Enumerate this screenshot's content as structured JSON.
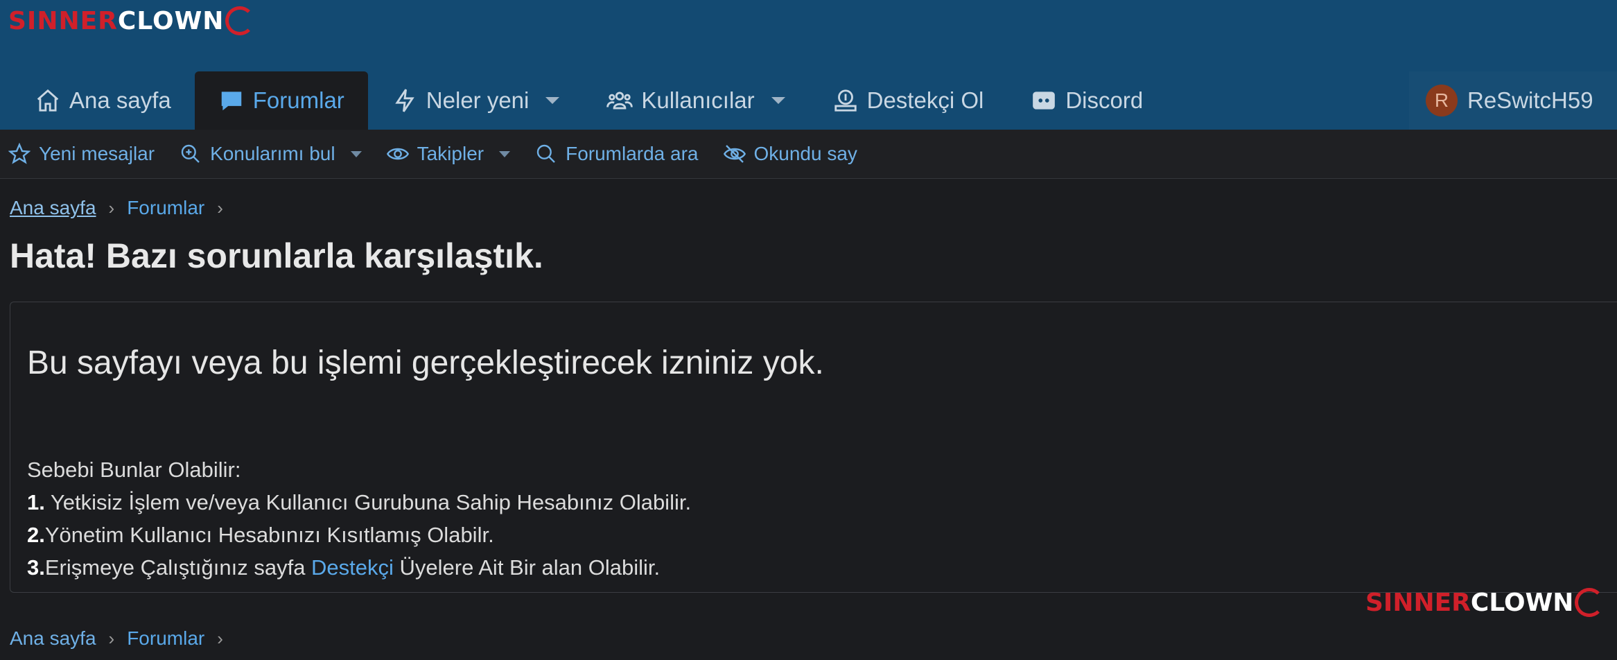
{
  "brand": {
    "part1": "SINNER",
    "part2": "CLOWN"
  },
  "main_nav": [
    {
      "label": "Ana sayfa",
      "icon": "home-icon"
    },
    {
      "label": "Forumlar",
      "icon": "comment-icon",
      "active": true
    },
    {
      "label": "Neler yeni",
      "icon": "bolt-icon",
      "dropdown": true
    },
    {
      "label": "Kullanıcılar",
      "icon": "users-icon",
      "dropdown": true
    },
    {
      "label": "Destekçi Ol",
      "icon": "donate-icon"
    },
    {
      "label": "Discord",
      "icon": "discord-icon"
    }
  ],
  "account": {
    "avatar_letter": "R",
    "username": "ReSwitcH59"
  },
  "sub_nav": [
    {
      "label": "Yeni mesajlar",
      "icon": "star-icon"
    },
    {
      "label": "Konularımı bul",
      "icon": "search-plus-icon",
      "dropdown": true
    },
    {
      "label": "Takipler",
      "icon": "eye-icon",
      "dropdown": true
    },
    {
      "label": "Forumlarda ara",
      "icon": "search-icon"
    },
    {
      "label": "Okundu say",
      "icon": "eye-slash-icon"
    }
  ],
  "breadcrumb": {
    "home": "Ana sayfa",
    "forums": "Forumlar"
  },
  "page_title": "Hata! Bazı sorunlarla karşılaştık.",
  "error": {
    "message": "Bu sayfayı veya bu işlemi gerçekleştirecek izniniz yok.",
    "reasons_heading": "Sebebi Bunlar Olabilir:",
    "r1_num": "1.",
    "r1_text": " Yetkisiz İşlem ve/veya Kullanıcı Gurubuna Sahip Hesabınız Olabilir.",
    "r2_num": "2.",
    "r2_text": "Yönetim Kullanıcı Hesabınızı Kısıtlamış Olabilr.",
    "r3_num": "3.",
    "r3_text_a": "Erişmeye Çalıştığınız sayfa ",
    "r3_link": "Destekçi",
    "r3_text_b": " Üyelere Ait Bir alan Olabilir."
  },
  "colors": {
    "header_bg": "#134a72",
    "page_bg": "#1b1c1f",
    "link": "#5aa9ea",
    "brand_red": "#d0202a"
  }
}
